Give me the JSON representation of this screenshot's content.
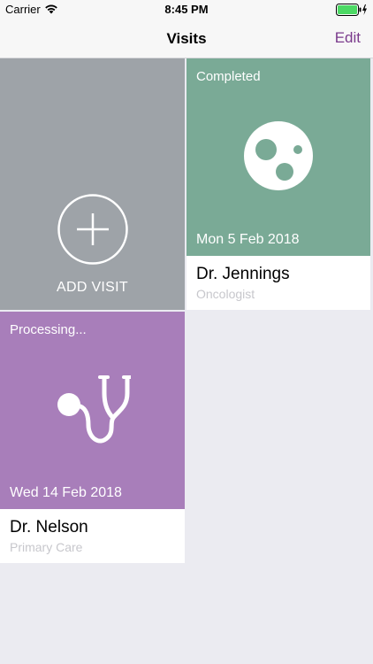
{
  "status_bar": {
    "carrier": "Carrier",
    "time": "8:45 PM",
    "wifi_icon": "wifi-icon",
    "battery_icon": "battery-charging-icon",
    "battery_color": "#4cd964"
  },
  "nav": {
    "title": "Visits",
    "edit_label": "Edit",
    "accent_color": "#7a3a8c"
  },
  "add_tile": {
    "label": "ADD VISIT",
    "icon": "plus-circle-icon",
    "color": "#9ea3a8"
  },
  "visits": [
    {
      "status": "Completed",
      "date": "Mon 5 Feb 2018",
      "doctor": "Dr. Jennings",
      "specialty": "Oncologist",
      "icon": "cells-icon",
      "color": "#7aaa96"
    },
    {
      "status": "Processing...",
      "date": "Wed 14 Feb 2018",
      "doctor": "Dr. Nelson",
      "specialty": "Primary Care",
      "icon": "stethoscope-icon",
      "color": "#a87eba"
    }
  ]
}
